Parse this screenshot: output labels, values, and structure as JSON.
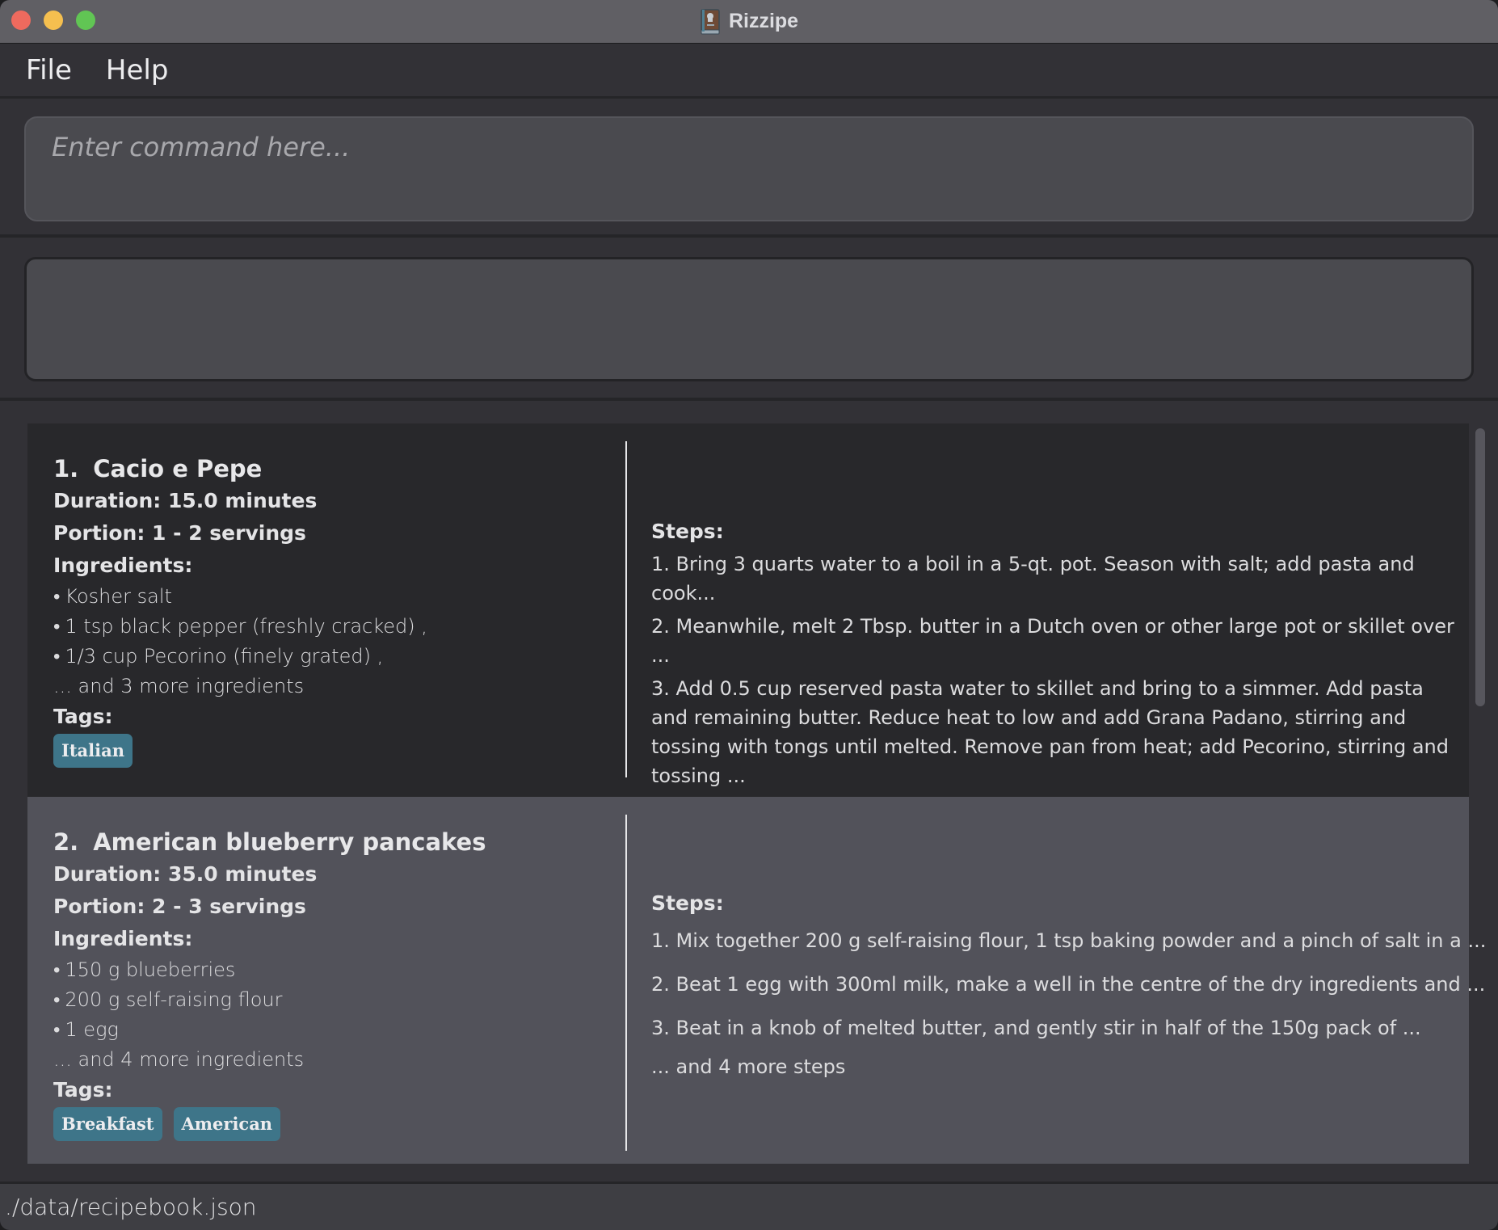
{
  "window": {
    "title": "Rizzipe",
    "icon": "recipe-book-icon"
  },
  "menu": {
    "items": [
      {
        "label": "File"
      },
      {
        "label": "Help"
      }
    ]
  },
  "command": {
    "value": "",
    "placeholder": "Enter command here..."
  },
  "result": {
    "text": ""
  },
  "recipes": [
    {
      "index": "1.",
      "name": "Cacio e Pepe",
      "duration": "Duration: 15.0 minutes",
      "portion": "Portion: 1 - 2 servings",
      "ingredients_label": "Ingredients:",
      "ingredients": [
        "Kosher salt",
        "1 tsp black pepper (freshly cracked) ,",
        "1/3 cup Pecorino (finely grated) ,"
      ],
      "ingredients_more": "... and 3 more ingredients",
      "tags_label": "Tags:",
      "tags": [
        "Italian"
      ],
      "steps_label": "Steps:",
      "steps": [
        "1. Bring 3 quarts water to a boil in a 5-qt. pot. Season with salt; add pasta and cook...",
        "2. Meanwhile, melt 2 Tbsp. butter in a Dutch oven or other large pot or skillet over ...",
        "3. Add 0.5 cup reserved pasta water to skillet and bring to a simmer. Add pasta and remaining butter. Reduce heat to low and add Grana Padano, stirring and tossing with tongs until melted. Remove pan from heat; add Pecorino, stirring and tossing ..."
      ],
      "steps_more": ""
    },
    {
      "index": "2.",
      "name": "American blueberry pancakes",
      "duration": "Duration: 35.0 minutes",
      "portion": "Portion: 2 - 3 servings",
      "ingredients_label": "Ingredients:",
      "ingredients": [
        "150 g blueberries",
        "200 g self-raising flour",
        "1 egg"
      ],
      "ingredients_more": "... and 4 more ingredients",
      "tags_label": "Tags:",
      "tags": [
        "Breakfast",
        "American"
      ],
      "steps_label": "Steps:",
      "steps": [
        "1. Mix together 200 g self-raising flour, 1 tsp baking powder and a pinch of salt in a ...",
        "2. Beat 1 egg with 300ml milk, make a well in the centre of the dry ingredients and ...",
        "3. Beat in a knob of melted butter, and gently stir in half of the 150g pack of ..."
      ],
      "steps_more": "... and 4 more steps"
    }
  ],
  "status": {
    "file_path": "./data/recipebook.json"
  },
  "colors": {
    "tag": "#3e7589",
    "selected_card": "#52525a",
    "card": "#28282b",
    "background": "#323136"
  }
}
